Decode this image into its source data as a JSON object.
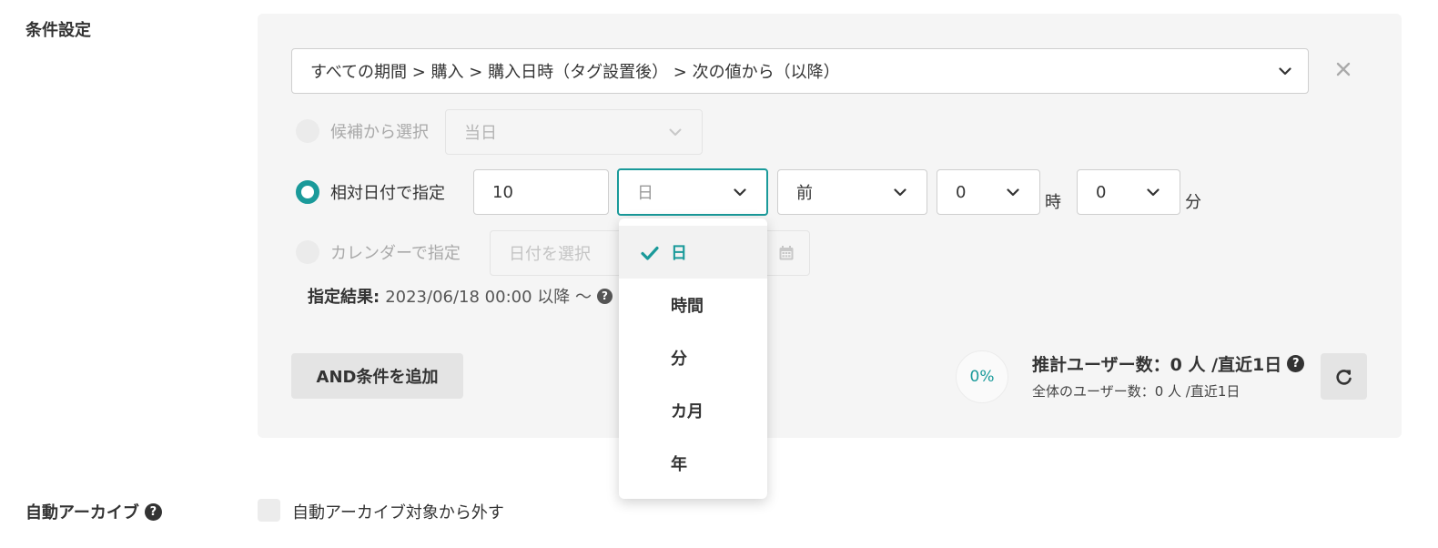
{
  "conditions": {
    "label": "条件設定",
    "path_select": {
      "value": "すべての期間 > 購入 > 購入日時（タグ設置後） > 次の値から（以降）"
    },
    "option_candidate": {
      "label": "候補から選択",
      "select_value": "当日"
    },
    "option_relative": {
      "label": "相対日付で指定",
      "amount": "10",
      "unit_value": "日",
      "direction": "前",
      "hour": "0",
      "hour_suffix": "時",
      "minute": "0",
      "minute_suffix": "分"
    },
    "option_calendar": {
      "label": "カレンダーで指定",
      "placeholder": "日付を選択"
    },
    "result": {
      "label": "指定結果:",
      "value": "2023/06/18 00:00 以降 〜"
    },
    "add_and_button": "AND条件を追加",
    "estimate": {
      "percent": "0%",
      "main": "推計ユーザー数：0 人 /直近1日",
      "sub": "全体のユーザー数：0 人 /直近1日"
    }
  },
  "unit_dropdown": {
    "options": [
      {
        "label": "日",
        "selected": true
      },
      {
        "label": "時間",
        "selected": false
      },
      {
        "label": "分",
        "selected": false
      },
      {
        "label": "カ月",
        "selected": false
      },
      {
        "label": "年",
        "selected": false
      }
    ]
  },
  "archive": {
    "label": "自動アーカイブ",
    "checkbox_label": "自動アーカイブ対象から外す",
    "checked": false
  },
  "icons": {
    "help": "question-circle-icon",
    "close": "close-icon",
    "chevron": "chevron-down-icon",
    "calendar": "calendar-icon",
    "refresh": "refresh-icon",
    "check": "check-icon"
  },
  "colors": {
    "accent": "#1a9a9a",
    "panel_bg": "#f5f5f5"
  }
}
